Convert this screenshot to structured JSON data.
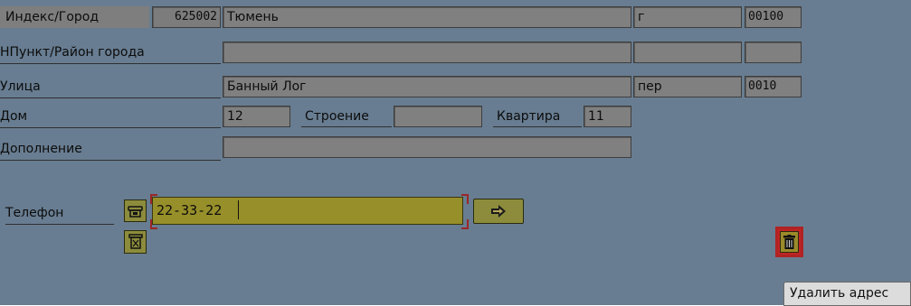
{
  "address": {
    "index_city": {
      "label": "Индекс/Город",
      "postal_code": "625002",
      "city": "Тюмень",
      "type": "г",
      "code": "00100"
    },
    "settlement": {
      "label": "НПункт/Район города",
      "value": "",
      "type": "",
      "code": ""
    },
    "street": {
      "label": "Улица",
      "value": "Банный Лог",
      "type": "пер",
      "code": "0010"
    },
    "house": {
      "label": "Дом",
      "value": "12",
      "building_label": "Строение",
      "building_value": "",
      "apartment_label": "Квартира",
      "apartment_value": "11"
    },
    "addition": {
      "label": "Дополнение",
      "value": ""
    }
  },
  "phone": {
    "label": "Телефон",
    "value": "22-33-22"
  },
  "actions": {
    "delete_address_label": "Удалить адрес"
  },
  "icons": [
    "phone-icon",
    "arrow-right-icon",
    "delete-phone-icon",
    "trash-icon"
  ],
  "colors": {
    "panel": "#687d91",
    "field": "#808080",
    "active_field": "#978f29",
    "button": "#8c8c3c",
    "highlight": "#b02323"
  }
}
